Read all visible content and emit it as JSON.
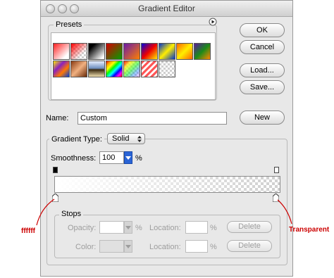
{
  "window": {
    "title": "Gradient Editor"
  },
  "presets": {
    "label": "Presets",
    "swatches": [
      {
        "name": "fg-to-bg",
        "bg": "linear-gradient(135deg,#ff2020,#ffffff 80%)"
      },
      {
        "name": "fg-to-transparent",
        "bg": "linear-gradient(135deg,#ff0000 0%,rgba(255,255,255,0) 70%)",
        "checker": true
      },
      {
        "name": "black-white",
        "bg": "linear-gradient(135deg,#000 20%,#fff 90%)"
      },
      {
        "name": "red-green",
        "bg": "linear-gradient(135deg,#d40000,#00a000)"
      },
      {
        "name": "violet-orange",
        "bg": "linear-gradient(135deg,#6a1aa8,#ff8000)"
      },
      {
        "name": "blue-red-yellow",
        "bg": "linear-gradient(135deg,#0000dd,#ee0000 50%,#ffee00)"
      },
      {
        "name": "blue-yellow-blue",
        "bg": "linear-gradient(135deg,#0033cc,#ffee00 50%,#0033cc)"
      },
      {
        "name": "orange-yellow-orange",
        "bg": "linear-gradient(135deg,#ff6600,#ffee00 50%,#ff6600)"
      },
      {
        "name": "violet-green-orange",
        "bg": "linear-gradient(135deg,#5a1a9a,#1a8a1a 50%,#ff8800)"
      },
      {
        "name": "yellow-violet-orange-blue",
        "bg": "linear-gradient(135deg,#ffee00,#8a20c0 35%,#ff7700 65%,#0040dd)"
      },
      {
        "name": "copper",
        "bg": "linear-gradient(135deg,#8a3a10,#f0b080 50%,#6a2a08)"
      },
      {
        "name": "chrome",
        "bg": "linear-gradient(180deg,#e8f0ff 0%,#7090c0 45%,#3a2a10 55%,#f0e0b0 100%)"
      },
      {
        "name": "spectrum",
        "bg": "linear-gradient(135deg,red,orange,yellow,lime,cyan,blue,magenta,red)"
      },
      {
        "name": "transparent-rainbow",
        "bg": "linear-gradient(135deg,rgba(255,0,0,0.9),rgba(255,255,0,0.7),rgba(0,255,0,0.5),rgba(0,120,255,0.4),rgba(255,0,255,0.2))",
        "checker": true
      },
      {
        "name": "transparent-stripes",
        "bg": "repeating-linear-gradient(135deg,#ff5555 0 3px,#ffffff 3px 6px)"
      },
      {
        "name": "transparent-checker",
        "bg": "transparent",
        "checker": true
      }
    ]
  },
  "buttons": {
    "ok": "OK",
    "cancel": "Cancel",
    "load": "Load...",
    "save": "Save...",
    "new": "New"
  },
  "name": {
    "label": "Name:",
    "value": "Custom"
  },
  "gradient_type": {
    "label": "Gradient Type:",
    "value": "Solid",
    "smoothness_label": "Smoothness:",
    "smoothness_value": "100",
    "smoothness_unit": "%"
  },
  "stops": {
    "label": "Stops",
    "opacity_label": "Opacity:",
    "opacity_unit": "%",
    "location_label": "Location:",
    "location_unit": "%",
    "color_label": "Color:",
    "delete_label": "Delete"
  },
  "annotations": {
    "left": "ffffff",
    "right": "Transparent"
  },
  "colors": {
    "annotation": "#cc0000",
    "accent": "#2a64d6"
  }
}
